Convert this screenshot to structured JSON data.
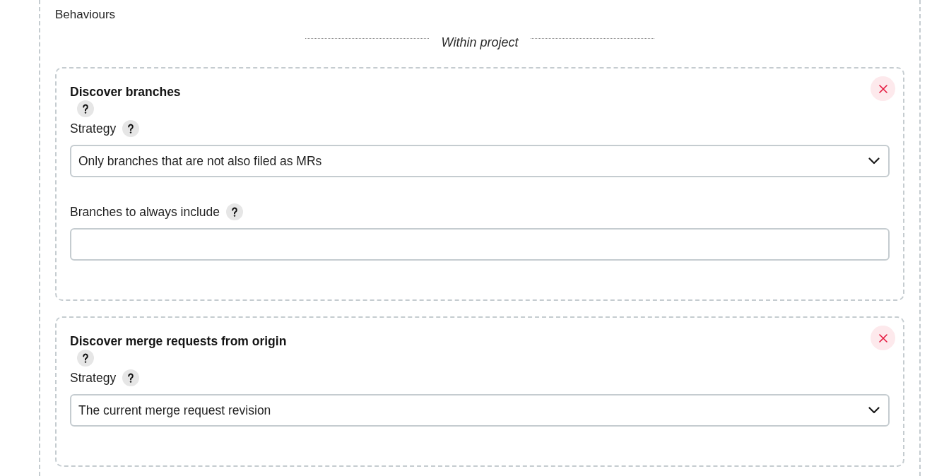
{
  "section": {
    "title": "Behaviours"
  },
  "group_heading": "Within project",
  "behaviours": [
    {
      "title": "Discover branches",
      "fields": [
        {
          "kind": "select",
          "label": "Strategy",
          "value": "Only branches that are not also filed as MRs"
        },
        {
          "kind": "text",
          "label": "Branches to always include"
        }
      ]
    },
    {
      "title": "Discover merge requests from origin",
      "fields": [
        {
          "kind": "select",
          "label": "Strategy",
          "value": "The current merge request revision"
        }
      ]
    }
  ]
}
